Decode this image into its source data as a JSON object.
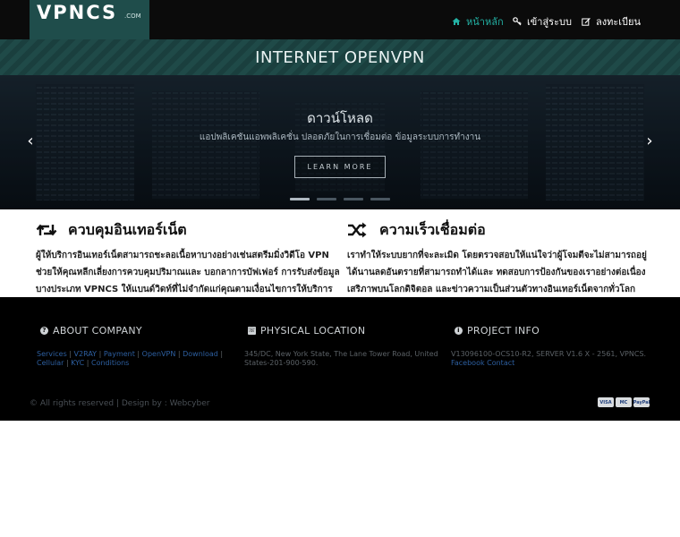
{
  "brand": {
    "logo_main": "VPNCS",
    "logo_sub": ".COM"
  },
  "nav": [
    {
      "label": "หน้าหลัก",
      "icon": "home-icon",
      "active": true
    },
    {
      "label": "เข้าสู่ระบบ",
      "icon": "key-icon",
      "active": false
    },
    {
      "label": "ลงทะเบียน",
      "icon": "edit-icon",
      "active": false
    }
  ],
  "banner": {
    "title": "INTERNET OPENVPN"
  },
  "hero": {
    "title": "ดาวน์โหลด",
    "subtitle": "แอปพลิเคชันแอพพลิเคชั่น ปลอดภัยในการเชื่อมต่อ ข้อมูลระบบการทำงาน",
    "button_label": "LEARN MORE",
    "slides": 4,
    "active_slide": 1,
    "prev": "‹",
    "next": "›"
  },
  "features": [
    {
      "icon": "retweet-icon",
      "title": "ควบคุมอินเทอร์เน็ต",
      "lines": [
        "ผู้ให้บริการอินเทอร์เน็ตสามารถชะลอเนื้อหาบางอย่างเช่นสตรีมมิ่งวิดีโอ VPN",
        "ช่วยให้คุณหลีกเลี่ยงการควบคุมปริมาณและ บอกลาการบัฟเฟอร์ การรับส่งข้อมูล",
        "บางประเภท VPNCS ให้แบนด์วิดท์ที่ไม่จำกัดแก่คุณตามเงื่อนไขการให้บริการ"
      ]
    },
    {
      "icon": "shuffle-icon",
      "title": "ความเร็วเชื่อมต่อ",
      "lines": [
        "เราทำให้ระบบยากที่จะละเมิด โดยตรวจสอบให้แน่ใจว่าผู้โจมตีจะไม่สามารถอยู่",
        "ได้นานลดอันตรายที่สามารถทำได้และ ทดสอบการป้องกันของเราอย่างต่อเนื่อง",
        "เสริภาพบนโลกดิจิตอล และข่าวความเป็นส่วนตัวทางอินเทอร์เน็ตจากทั่วโลก"
      ]
    }
  ],
  "footer": {
    "about": {
      "heading": "ABOUT COMPANY",
      "links": [
        "Services",
        "V2RAY",
        "Payment",
        "OpenVPN",
        "Download",
        "Cellular",
        "KYC",
        "Conditions"
      ]
    },
    "location": {
      "heading": "PHYSICAL LOCATION",
      "text": "345/DC, New York State, The Lane Tower Road, United States-201-900-590."
    },
    "project": {
      "heading": "PROJECT INFO",
      "text": "V13096100-OCS10-R2, SERVER V1.6 X - 2561, VPNCS.",
      "link": "Facebook Contact"
    },
    "copyright": "© All rights reserved | Design by : Webcyber",
    "cards": [
      "VISA",
      "MC",
      "PayPal"
    ]
  },
  "colors": {
    "accent": "#23b3a6",
    "logo_bg": "#1f4d4b",
    "footer_bg": "#000000",
    "link": "#2d5fa0"
  }
}
